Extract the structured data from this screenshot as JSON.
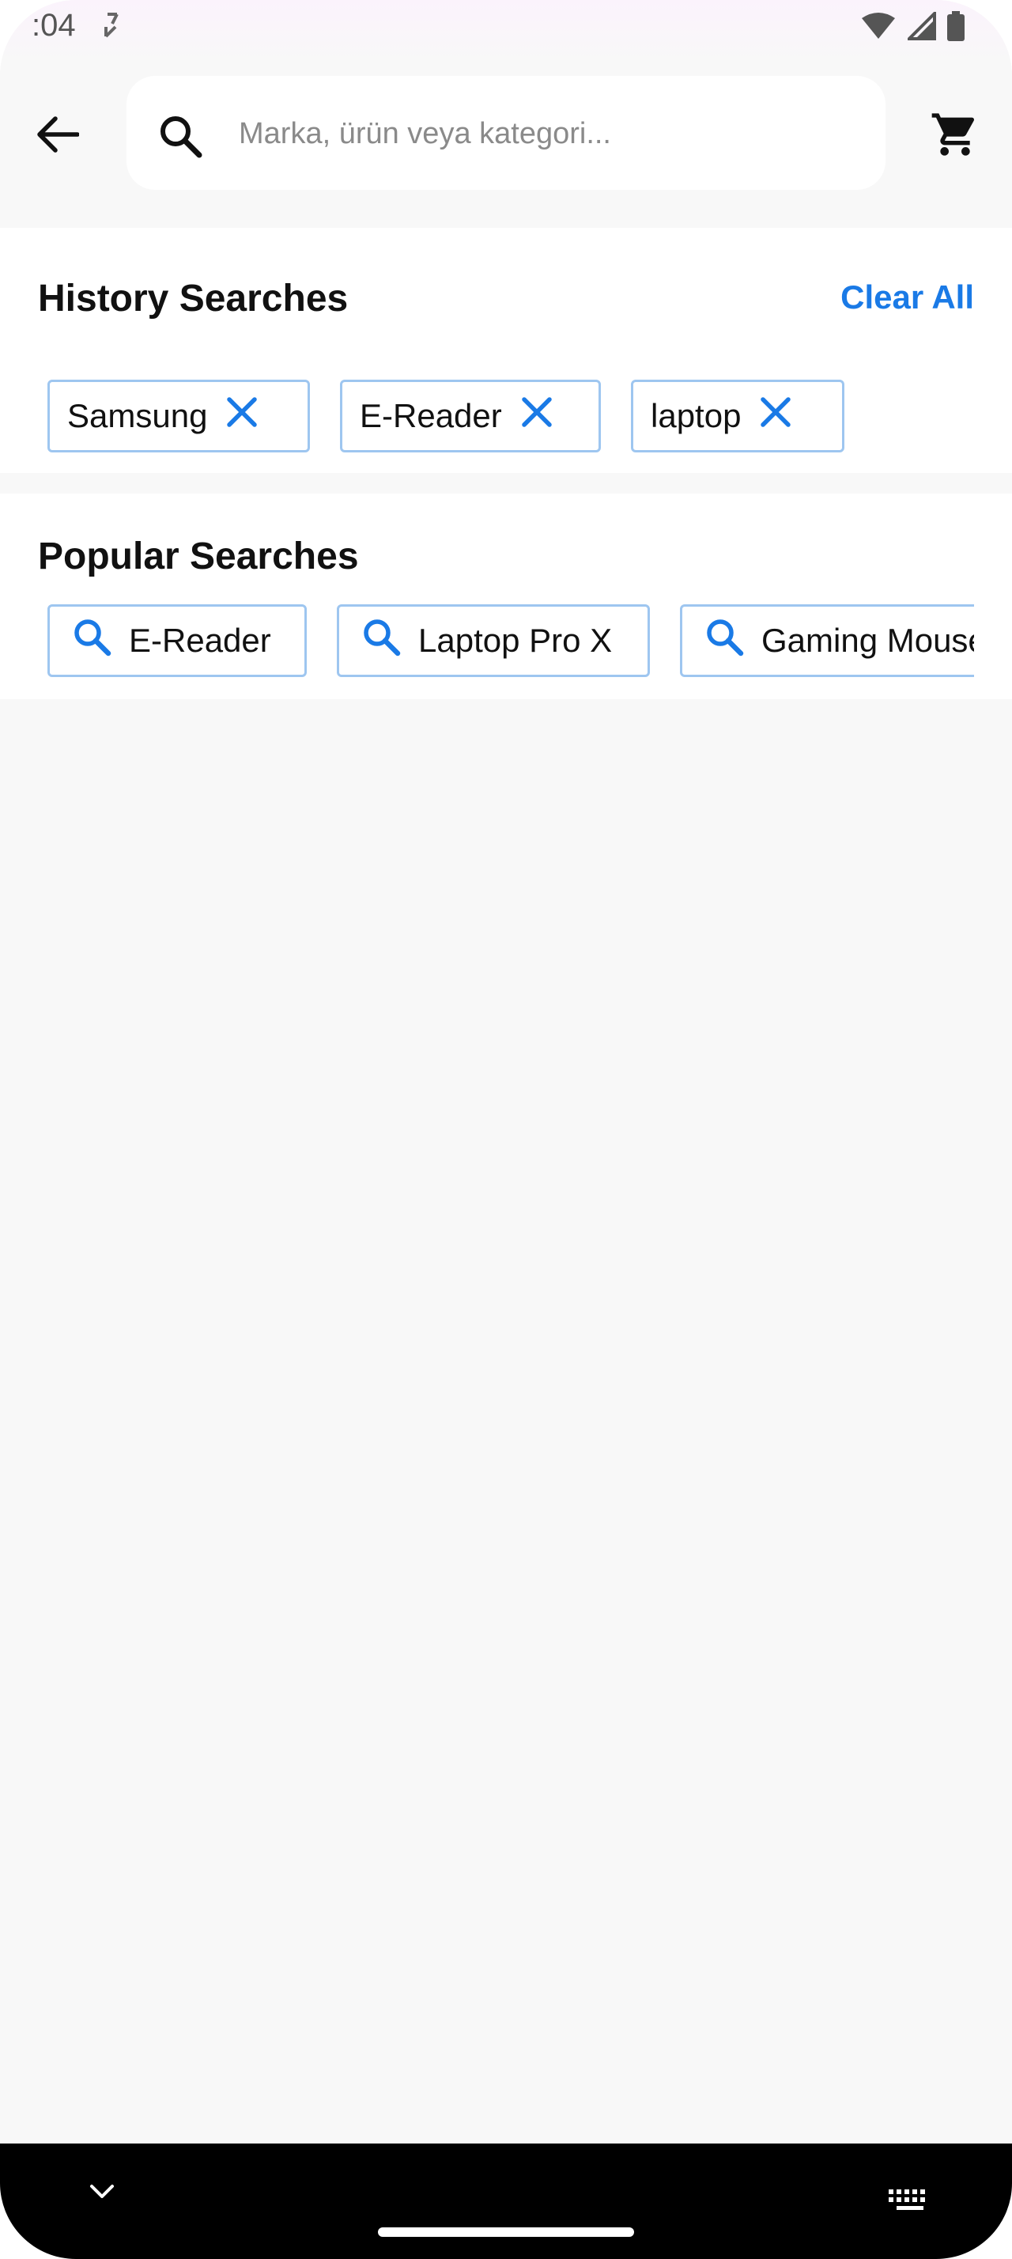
{
  "status_bar": {
    "time": ":04"
  },
  "search": {
    "placeholder": "Marka, ürün veya kategori..."
  },
  "history": {
    "title": "History Searches",
    "clear_label": "Clear All",
    "items": [
      {
        "label": "Samsung"
      },
      {
        "label": "E-Reader"
      },
      {
        "label": "laptop"
      }
    ]
  },
  "popular": {
    "title": "Popular Searches",
    "items": [
      {
        "label": "E-Reader"
      },
      {
        "label": "Laptop Pro X"
      },
      {
        "label": "Gaming Mouse"
      }
    ]
  },
  "colors": {
    "accent": "#1a7ae6",
    "chip_border": "#9ec6f0",
    "background": "#f8f8f8"
  },
  "icons": [
    "back-arrow-icon",
    "search-icon",
    "cart-icon",
    "close-icon",
    "chevron-down-icon",
    "keyboard-icon"
  ]
}
